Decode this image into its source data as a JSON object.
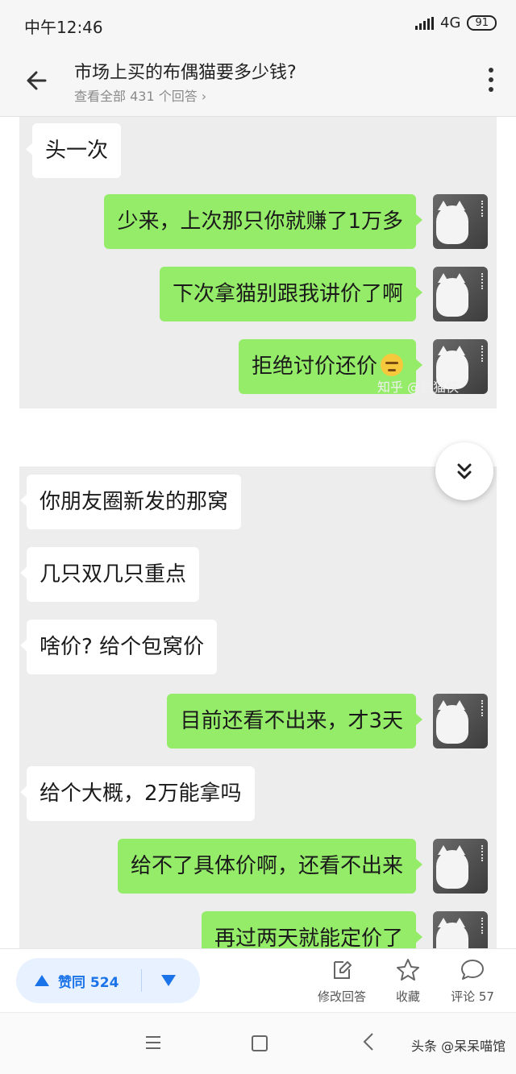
{
  "status_bar": {
    "time": "中午12:46",
    "network": "4G",
    "battery": "91"
  },
  "header": {
    "title": "市场上买的布偶猫要多少钱?",
    "subtitle": "查看全部 431 个回答 ›"
  },
  "screenshot1": {
    "messages": [
      {
        "side": "left",
        "text": "头一次"
      },
      {
        "side": "right",
        "text": "少来，上次那只你就赚了1万多"
      },
      {
        "side": "right",
        "text": "下次拿猫别跟我讲价了啊"
      },
      {
        "side": "right",
        "text": "拒绝讨价还价",
        "emoji": "smirk-emoji"
      }
    ],
    "watermark": "知乎 @猫猫侠"
  },
  "screenshot2": {
    "messages": [
      {
        "side": "left",
        "text": "你朋友圈新发的那窝"
      },
      {
        "side": "left",
        "text": "几只双几只重点"
      },
      {
        "side": "left",
        "text": "啥价? 给个包窝价"
      },
      {
        "side": "right",
        "text": "目前还看不出来，才3天"
      },
      {
        "side": "left",
        "text": "给个大概，2万能拿吗"
      },
      {
        "side": "right",
        "text": "给不了具体价啊，还看不出来"
      },
      {
        "side": "right",
        "text": "再过两天就能定价了"
      }
    ]
  },
  "action_bar": {
    "upvote_label": "赞同 524",
    "edit_label": "修改回答",
    "collect_label": "收藏",
    "comment_label": "评论 57"
  },
  "footer": {
    "brand": "头条 @呆呆喵馆"
  },
  "colors": {
    "accent": "#1a73e8",
    "bubble_green": "#95ec69",
    "chat_bg": "#ededed"
  }
}
